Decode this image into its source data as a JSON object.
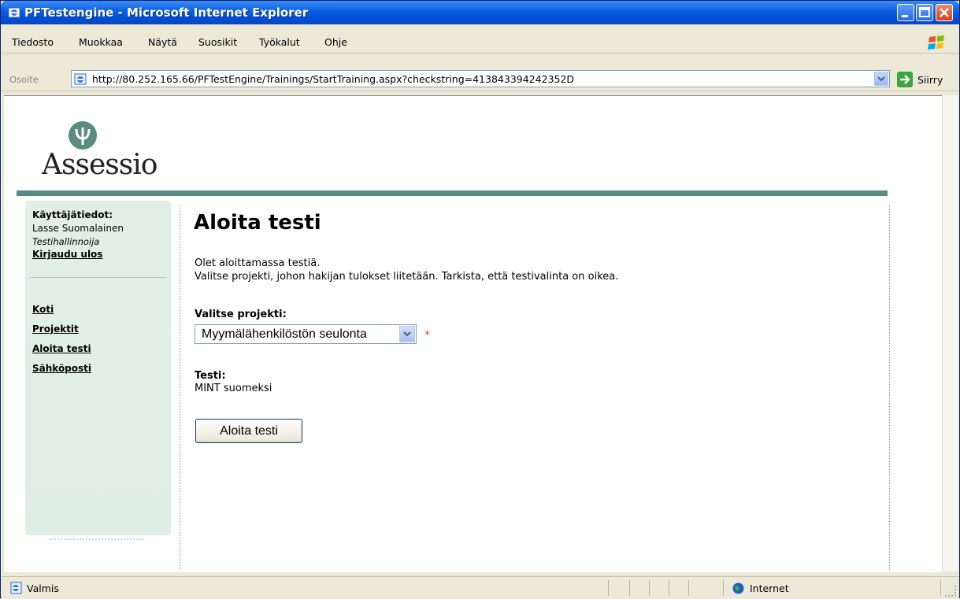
{
  "window": {
    "title": "PFTestengine - Microsoft Internet Explorer",
    "title_color": "#0054e3"
  },
  "menu": {
    "items": [
      "Tiedosto",
      "Muokkaa",
      "Näytä",
      "Suosikit",
      "Työkalut",
      "Ohje"
    ]
  },
  "address": {
    "label": "Osoite",
    "url": "http://80.252.165.66/PFTestEngine/Trainings/StartTraining.aspx?checkstring=413843394242352D",
    "go_label": "Siirry"
  },
  "page": {
    "logo": "Assessio",
    "logo_color": "#5b8a80",
    "sidebar": {
      "user_heading": "Käyttäjätiedot:",
      "user_name": "Lasse Suomalainen",
      "user_role": "Testihallinnoija",
      "logout": "Kirjaudu ulos",
      "nav": [
        "Koti",
        "Projektit",
        "Aloita testi",
        "Sähköposti"
      ]
    },
    "heading": "Aloita testi",
    "intro_line1": "Olet aloittamassa testiä.",
    "intro_line2": "Valitse projekti, johon hakijan tulokset liitetään. Tarkista, että testivalinta on oikea.",
    "project_label": "Valitse projekti:",
    "project_value": "Myymälähenkilöstön seulonta",
    "required_mark": "*",
    "test_label": "Testi:",
    "test_value": "MINT suomeksi",
    "start_button": "Aloita testi"
  },
  "status": {
    "text": "Valmis",
    "zone": "Internet"
  },
  "icons": [
    "ie-icon",
    "minimize-icon",
    "maximize-icon",
    "close-icon",
    "windows-flag-icon",
    "go-arrow-icon",
    "dropdown-arrow-icon",
    "globe-icon",
    "page-icon"
  ]
}
